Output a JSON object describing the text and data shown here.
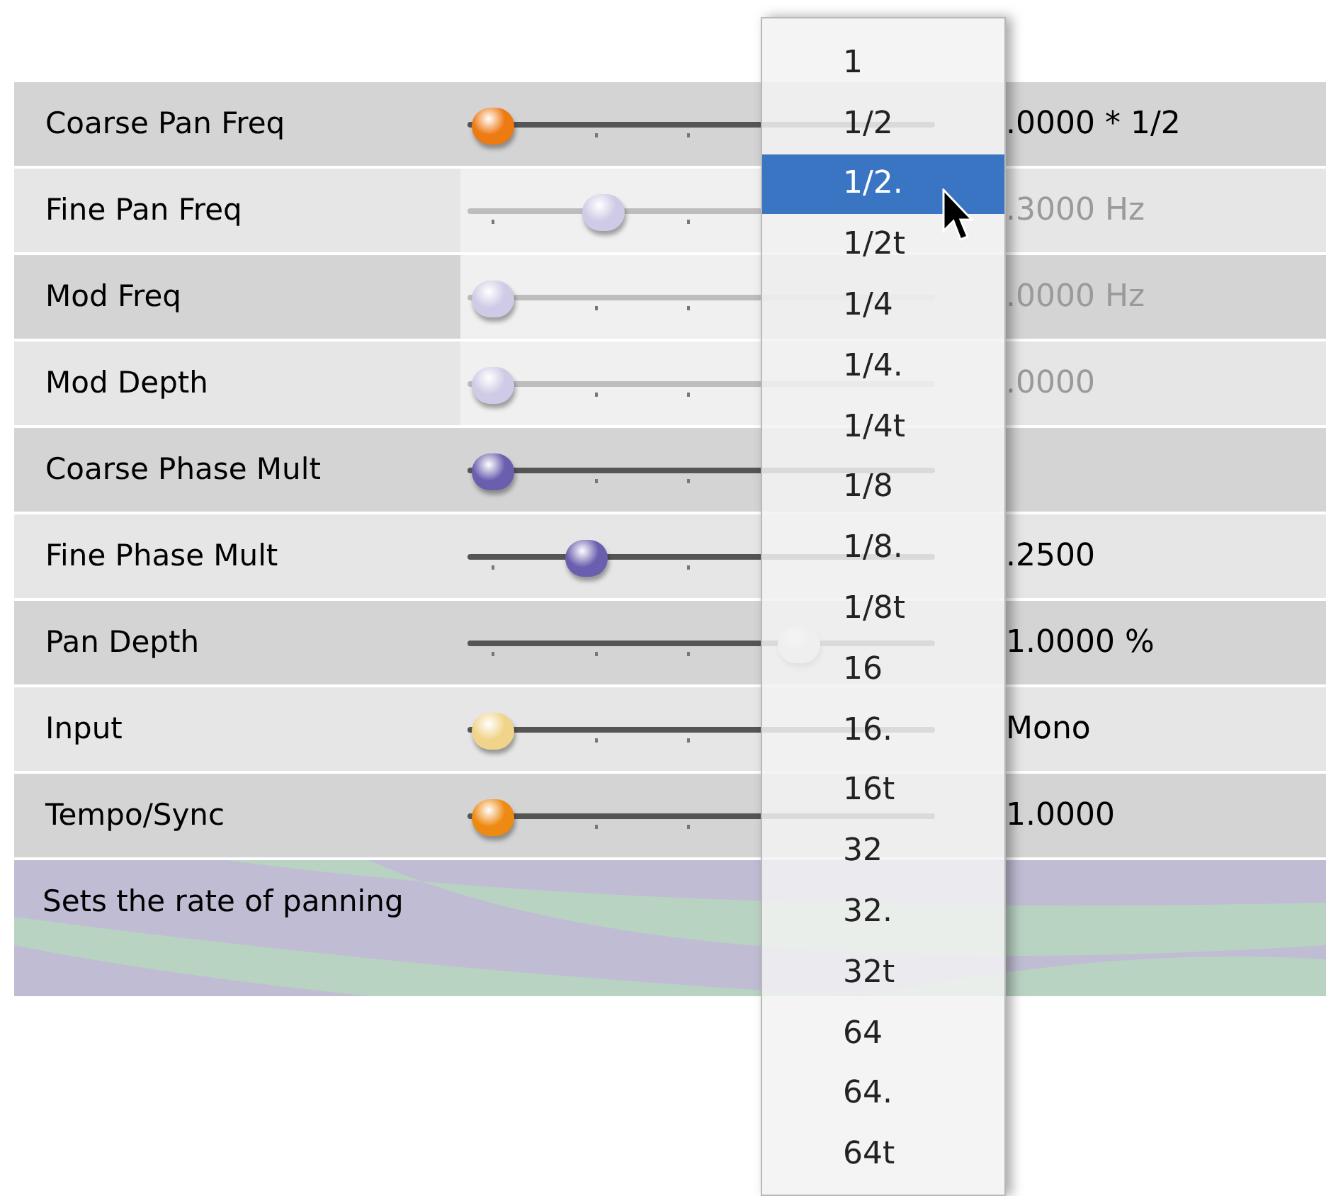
{
  "parameters": [
    {
      "label": "Coarse Pan Freq",
      "disabled": false,
      "level": 0,
      "color": "#ee7a12",
      "value": ".0000 * 1/2"
    },
    {
      "label": "Fine Pan Freq",
      "disabled": true,
      "level": 0.26,
      "color": "#cfcbe6",
      "value": ".3000 Hz"
    },
    {
      "label": "Mod Freq",
      "disabled": true,
      "level": 0,
      "color": "#cfcbe6",
      "value": ".0000 Hz"
    },
    {
      "label": "Mod Depth",
      "disabled": true,
      "level": 0,
      "color": "#cfcbe6",
      "value": ".0000"
    },
    {
      "label": "Coarse Phase Mult",
      "disabled": false,
      "level": 0,
      "color": "#6a5fae"
    },
    {
      "label": "Fine Phase Mult",
      "disabled": false,
      "level": 0.22,
      "color": "#6a5fae",
      "value": ".2500"
    },
    {
      "label": "Pan Depth",
      "disabled": false,
      "level": 0.72,
      "value": "1.0000 %"
    },
    {
      "label": "Input",
      "disabled": false,
      "level": 0,
      "color": "#f0d48a",
      "value": "Mono"
    },
    {
      "label": "Tempo/Sync",
      "disabled": false,
      "level": 0,
      "color": "#ee8a12",
      "value": "1.0000"
    }
  ],
  "description": "Sets the rate of panning",
  "menu": [
    {
      "label": "1",
      "selected": false
    },
    {
      "label": "1/2",
      "selected": false
    },
    {
      "label": "1/2.",
      "selected": true
    },
    {
      "label": "1/2t",
      "selected": false
    },
    {
      "label": "1/4",
      "selected": false
    },
    {
      "label": "1/4.",
      "selected": false
    },
    {
      "label": "1/4t",
      "selected": false
    },
    {
      "label": "1/8",
      "selected": false
    },
    {
      "label": "1/8.",
      "selected": false
    },
    {
      "label": "1/8t",
      "selected": false
    },
    {
      "label": "16",
      "selected": false
    },
    {
      "label": "16.",
      "selected": false
    },
    {
      "label": "16t",
      "selected": false
    },
    {
      "label": "32",
      "selected": false
    },
    {
      "label": "32.",
      "selected": false
    },
    {
      "label": "32t",
      "selected": false
    },
    {
      "label": "64",
      "selected": false
    },
    {
      "label": "64.",
      "selected": false
    },
    {
      "label": "64t",
      "selected": false
    }
  ]
}
